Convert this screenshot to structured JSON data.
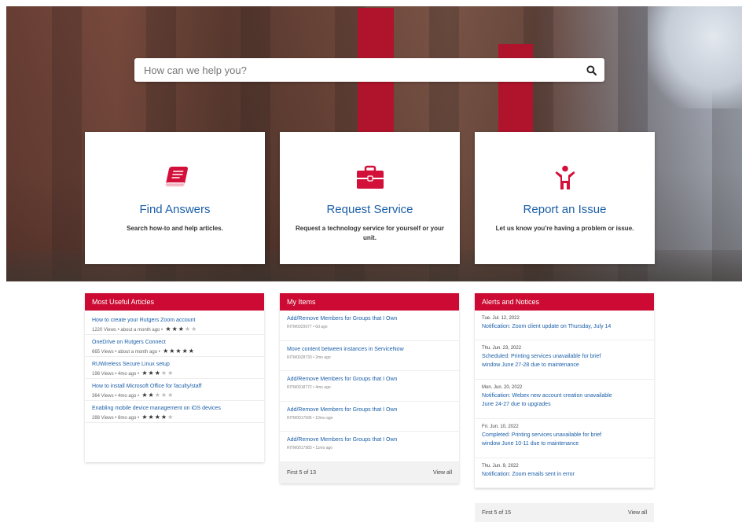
{
  "search": {
    "placeholder": "How can we help you?",
    "icon": "search-icon"
  },
  "tiles": [
    {
      "title": "Find Answers",
      "description": "Search how-to and help articles.",
      "icon": "book-icon"
    },
    {
      "title": "Request Service",
      "description": "Request a technology service for yourself or your unit.",
      "icon": "briefcase-icon"
    },
    {
      "title": "Report an Issue",
      "description": "Let us know you're having a problem or issue.",
      "icon": "person-raising-hand-icon"
    }
  ],
  "colors": {
    "accent": "#cc0a33",
    "link": "#1b5fa8",
    "icon": "#d3103a"
  },
  "articles": {
    "header": "Most Useful Articles",
    "items": [
      {
        "title": "How to create your Rutgers Zoom account",
        "meta": "1220 Views  •  about a month ago  •",
        "rating": 3
      },
      {
        "title": "OneDrive on Rutgers Connect",
        "meta": "665 Views  •  about a month ago  •",
        "rating": 5
      },
      {
        "title": "RUWireless Secure Linux setup",
        "meta": "198 Views  •  4mo ago  •",
        "rating": 3
      },
      {
        "title": "How to install Microsoft Office for faculty/staff",
        "meta": "364 Views  •  4mo ago  •",
        "rating": 2
      },
      {
        "title": "Enabling mobile device management on iOS devices",
        "meta": "288 Views  •  8mo ago  •",
        "rating": 4
      }
    ]
  },
  "myitems": {
    "header": "My Items",
    "items": [
      {
        "title": "Add/Remove Members for Groups that I Own",
        "meta": "RITM0029977 • 6d ago"
      },
      {
        "title": "Move content between instances in ServiceNow",
        "meta": "RITM0028730 • 2mo ago"
      },
      {
        "title": "Add/Remove Members for Groups that I Own",
        "meta": "RITM0018772 • 4mo ago"
      },
      {
        "title": "Add/Remove Members for Groups that I Own",
        "meta": "RITM0017695 • 10mo ago"
      },
      {
        "title": "Add/Remove Members for Groups that I Own",
        "meta": "RITM0017983 • 11mo ago"
      }
    ],
    "footer": "First 5 of 13",
    "view_all": "View all"
  },
  "alerts": {
    "header": "Alerts and Notices",
    "items": [
      {
        "date": "Tue. Jul. 12, 2022",
        "lines": [
          "Notification: Zoom client update on Thursday, July 14"
        ]
      },
      {
        "date": "Thu. Jun. 23, 2022",
        "lines": [
          "Scheduled: Printing services unavailable for brief",
          "window June 27-28 due to maintenance"
        ]
      },
      {
        "date": "Mon. Jun. 20, 2022",
        "lines": [
          "Notification: Webex new account creation unavailable",
          "June 24-27 due to upgrades"
        ]
      },
      {
        "date": "Fri. Jun. 10, 2022",
        "lines": [
          "Completed: Printing services unavailable for brief",
          "window June 10-11 due to maintenance"
        ]
      },
      {
        "date": "Thu. Jun. 9, 2022",
        "lines": [
          "Notification: Zoom emails sent in error"
        ]
      }
    ],
    "footer": "First 5 of 15",
    "view_all": "View all"
  }
}
